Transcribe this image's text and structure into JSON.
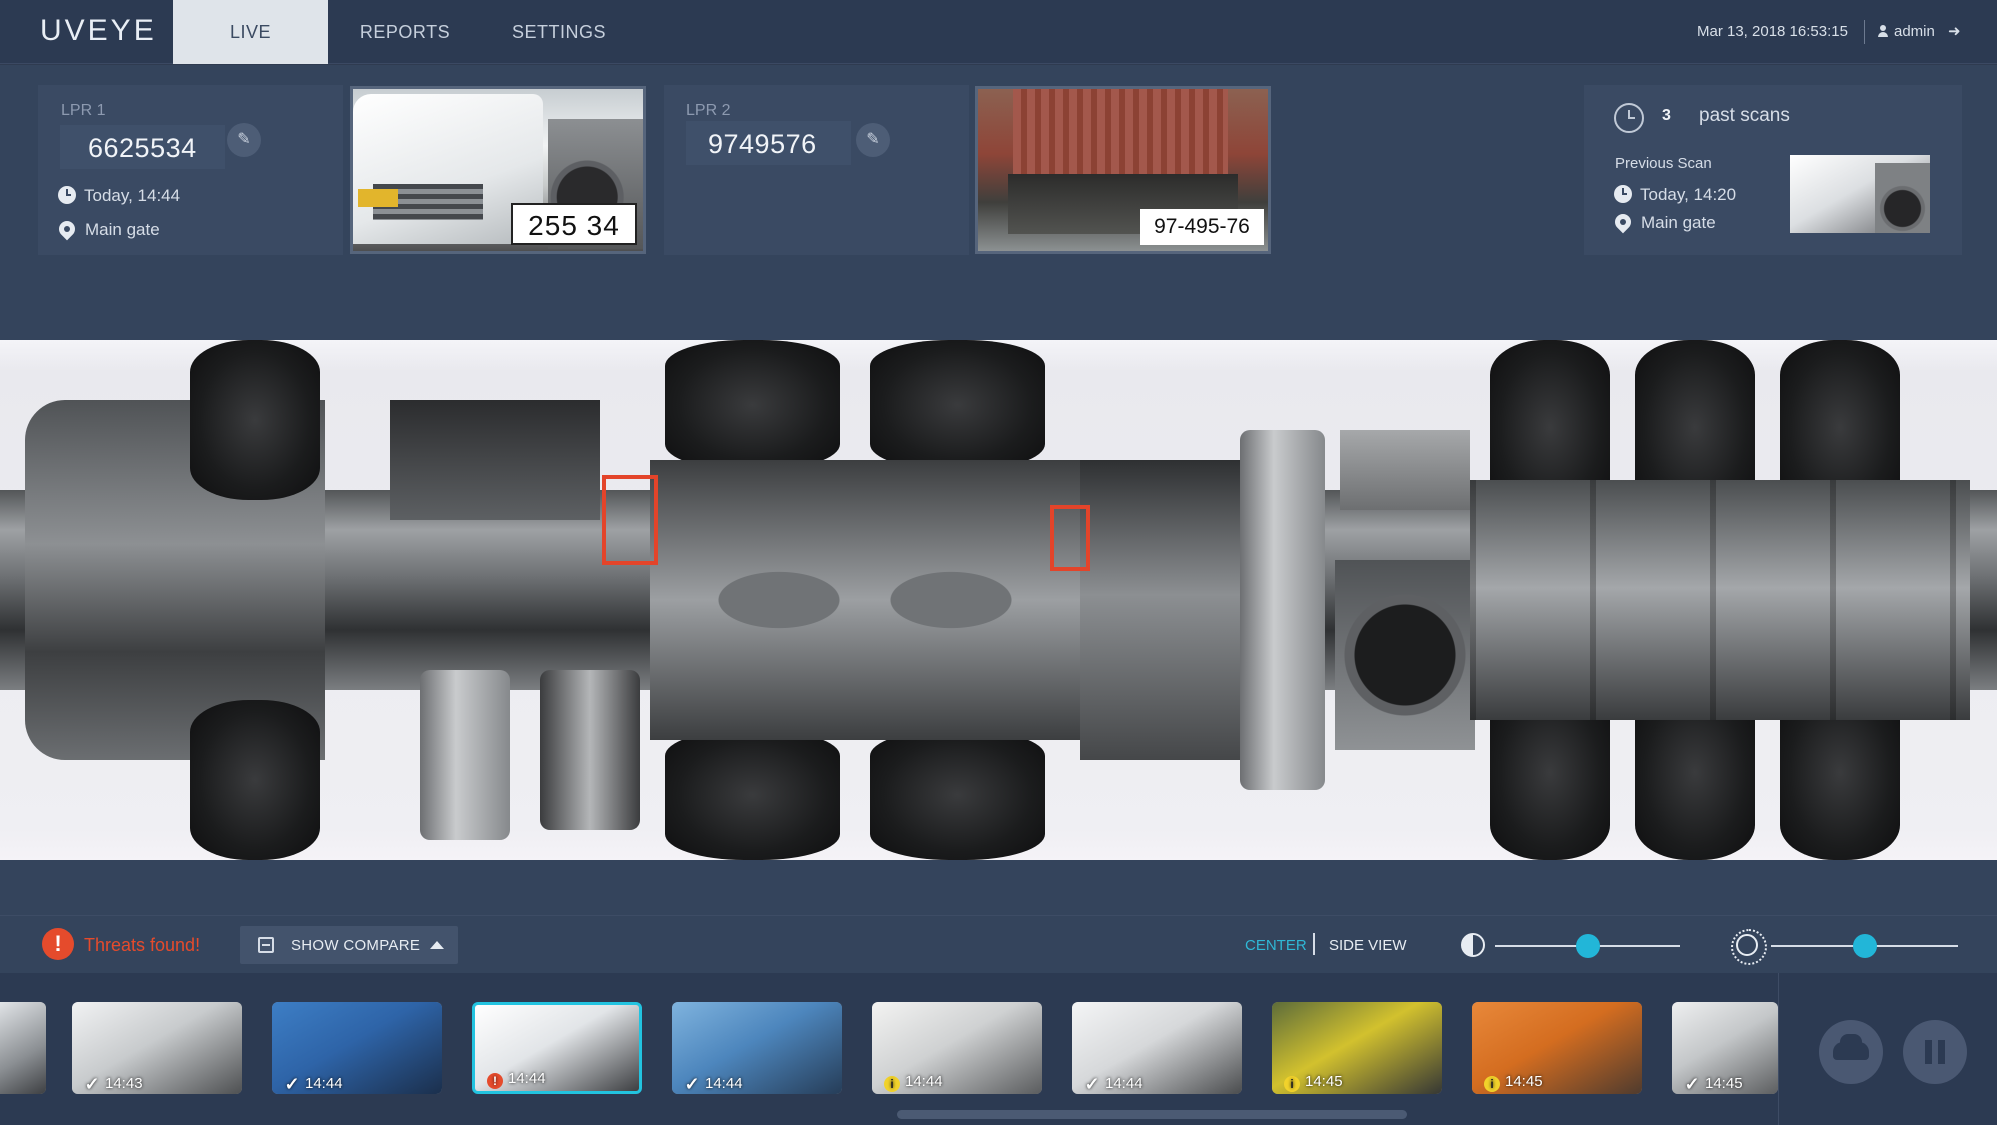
{
  "brand": {
    "logo": "UVEYE"
  },
  "nav": {
    "tabs": [
      {
        "label": "LIVE",
        "active": true
      },
      {
        "label": "REPORTS",
        "active": false
      },
      {
        "label": "SETTINGS",
        "active": false
      }
    ],
    "datetime": "Mar 13, 2018 16:53:15",
    "user": "admin"
  },
  "lpr1": {
    "label": "LPR 1",
    "plate": "6625534",
    "time": "Today, 14:44",
    "location": "Main gate",
    "snapshot_plate": "255 34"
  },
  "lpr2": {
    "label": "LPR 2",
    "plate": "9749576",
    "snapshot_plate": "97-495-76"
  },
  "past_scans": {
    "count": "3",
    "label": "past scans",
    "previous_label": "Previous Scan",
    "previous_time": "Today, 14:20",
    "previous_location": "Main gate"
  },
  "controls": {
    "threat_text": "Threats found!",
    "compare_label": "SHOW COMPARE",
    "view_center": "CENTER",
    "view_side": "SIDE VIEW",
    "contrast_level": 0.5,
    "brightness_level": 0.5,
    "accent_color": "#22b6d8",
    "threat_color": "#e54b2c"
  },
  "thumbnails": [
    {
      "time": "14:43",
      "status": "ok"
    },
    {
      "time": "14:44",
      "status": "ok"
    },
    {
      "time": "14:44",
      "status": "threat",
      "selected": true
    },
    {
      "time": "14:44",
      "status": "ok"
    },
    {
      "time": "14:44",
      "status": "info"
    },
    {
      "time": "14:44",
      "status": "ok"
    },
    {
      "time": "14:45",
      "status": "info"
    },
    {
      "time": "14:45",
      "status": "info"
    },
    {
      "time": "14:45",
      "status": "ok"
    }
  ]
}
